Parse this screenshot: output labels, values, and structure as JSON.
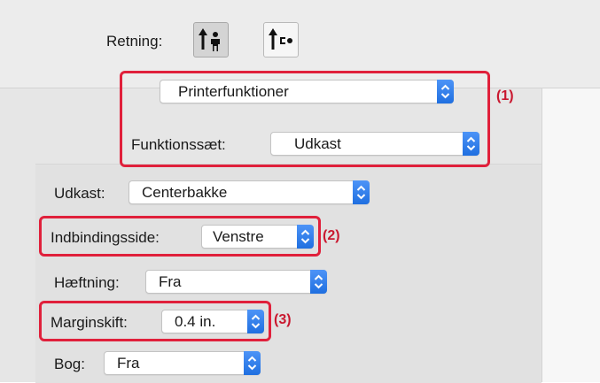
{
  "orientation": {
    "label": "Retning:",
    "portrait_icon": "portrait-orientation-icon",
    "landscape_icon": "landscape-orientation-icon",
    "selected": "portrait"
  },
  "panel_select": {
    "value": "Printerfunktioner"
  },
  "feature_set": {
    "label": "Funktionssæt:",
    "value": "Udkast"
  },
  "output": {
    "label": "Udkast:",
    "value": "Centerbakke"
  },
  "binding_edge": {
    "label": "Indbindingsside:",
    "value": "Venstre"
  },
  "staple": {
    "label": "Hæftning:",
    "value": "Fra"
  },
  "margin_shift": {
    "label": "Marginskift:",
    "value": "0.4 in."
  },
  "booklet": {
    "label": "Bog:",
    "value": "Fra"
  },
  "callouts": {
    "c1": "(1)",
    "c2": "(2)",
    "c3": "(3)"
  },
  "colors": {
    "callout": "#e0203b",
    "accent": "#2a7cf0"
  }
}
